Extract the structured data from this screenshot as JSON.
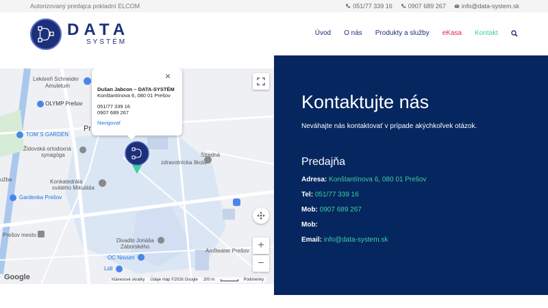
{
  "topbar": {
    "tagline": "Autorizovaný predajca pokladní ELCOM",
    "phone1": "051/77 339 16",
    "phone2": "0907 689 267",
    "email": "info@data-system.sk"
  },
  "logo": {
    "big": "DATA",
    "small": "SYSTÉM"
  },
  "nav": {
    "items": [
      "Úvod",
      "O nás",
      "Produkty a služby",
      "eKasa",
      "Kontakt"
    ]
  },
  "map": {
    "popup": {
      "title": "Dušan Jabcon – DATA-SYSTÉM",
      "address": "Konštantínova 6, 080 01 Prešov",
      "phone1": "051/77 339 16",
      "phone2": "0907 689 267",
      "navigate": "Navigovať",
      "close": "×"
    },
    "labels": {
      "l1": "Lekáreň Schneider",
      "l2": "Amuletum",
      "l3": "OLYMP Prešov",
      "l4": "TOM´S GARDEN",
      "l5": "Židovská ortodoxná",
      "l6": "synagóga",
      "l7": "Stredná",
      "l8": "zdravotnícka škola",
      "l9": "Konkatedrála",
      "l10": "svätého Mikuláša",
      "l11": "Gardenka Prešov",
      "l12": "Prešov mesto",
      "l13": "Divadlo Jonáša",
      "l14": "Záborského",
      "l15": "Amfiteáter Prešov",
      "l16": "OC Novum",
      "l17": "Lidl",
      "l18": "Pr",
      "l19": "užba"
    },
    "footer": {
      "shortcuts": "Klávesové skratky",
      "data": "Údaje máp ©2026 Google",
      "scale": "200 m",
      "terms": "Podmienky"
    },
    "google": "Google",
    "zoom_in": "+",
    "zoom_out": "−"
  },
  "contact": {
    "title": "Kontaktujte nás",
    "subtitle": "Neváhajte nás kontaktovať v prípade akýchkoľvek otázok.",
    "section": "Predajňa",
    "rows": [
      {
        "label": "Adresa:",
        "value": "Konštantínova 6, 080 01 Prešov"
      },
      {
        "label": "Tel:",
        "value": "051/77 339 16"
      },
      {
        "label": "Mob:",
        "value": "0907 689 267"
      },
      {
        "label": "Mob:",
        "value": ""
      },
      {
        "label": "Email:",
        "value": "info@data-system.sk"
      }
    ]
  },
  "colors": {
    "navy": "#06265f",
    "brand": "#1c2f7a",
    "accent": "#3bd2a0",
    "ekasa": "#d9254e"
  }
}
